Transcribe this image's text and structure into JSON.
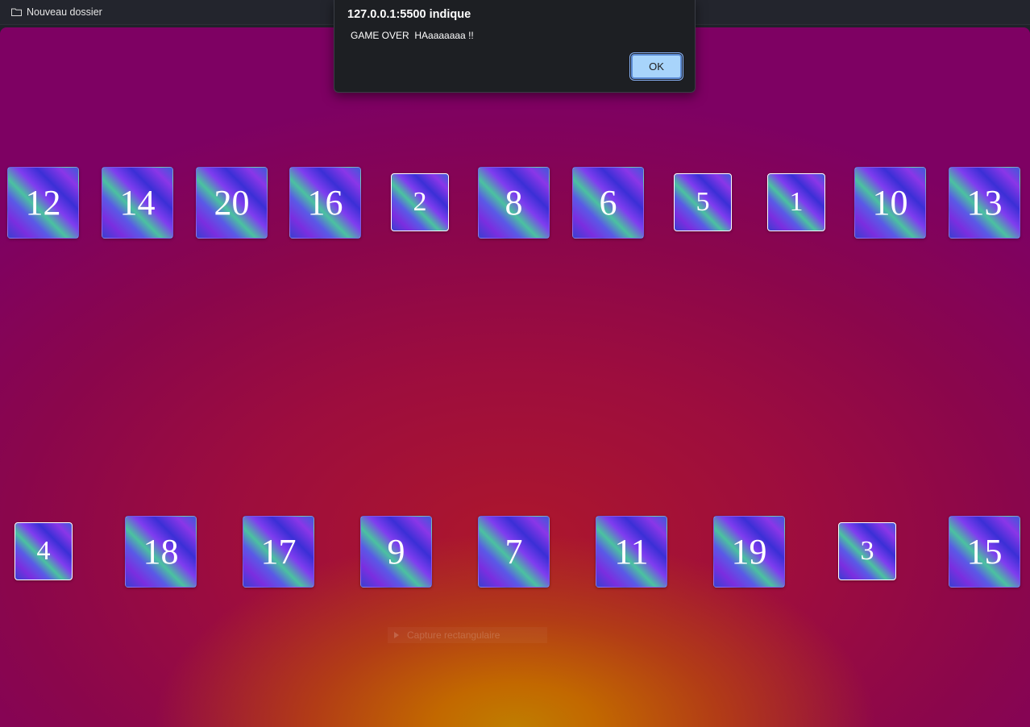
{
  "browser": {
    "bookmark": {
      "icon": "folder-icon",
      "label": "Nouveau dossier"
    }
  },
  "game": {
    "top_row": [
      "12",
      "14",
      "20",
      "16",
      "2",
      "8",
      "6",
      "5",
      "1",
      "10",
      "13"
    ],
    "bottom_row": [
      "4",
      "18",
      "17",
      "9",
      "7",
      "11",
      "19",
      "3",
      "15"
    ]
  },
  "alert": {
    "title": "127.0.0.1:5500 indique",
    "message": "GAME OVER  HAaaaaaaa !!",
    "ok_label": "OK"
  },
  "overlay": {
    "faint_label": "Capture rectangulaire"
  },
  "colors": {
    "background_top": "#7e0163",
    "background_mid": "#ad172c",
    "background_glow": "#c07d00",
    "card_blue": "#3a3fd0",
    "card_purple": "#7b2ee0",
    "card_teal": "#4bc2a0",
    "dialog_bg": "#1d1f23",
    "ok_button": "#a8d4fb"
  }
}
